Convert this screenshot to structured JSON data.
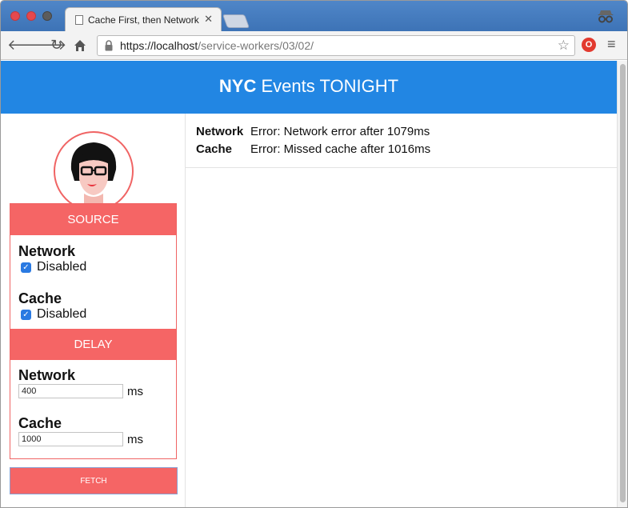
{
  "browser": {
    "tab_title": "Cache First, then Network",
    "url_host": "https://localhost",
    "url_path": "/service-workers/03/02/"
  },
  "page": {
    "header_bold": "NYC",
    "header_rest": " Events TONIGHT",
    "source_heading": "SOURCE",
    "source_network_title": "Network",
    "source_network_check": "Disabled",
    "source_cache_title": "Cache",
    "source_cache_check": "Disabled",
    "delay_heading": "DELAY",
    "delay_network_title": "Network",
    "delay_network_value": "400",
    "delay_network_unit": "ms",
    "delay_cache_title": "Cache",
    "delay_cache_value": "1000",
    "delay_cache_unit": "ms",
    "fetch_label": "FETCH",
    "log": [
      {
        "label": "Network",
        "message": "Error: Network error after 1079ms"
      },
      {
        "label": "Cache",
        "message": "Error: Missed cache after 1016ms"
      }
    ]
  },
  "colors": {
    "header": "#2286e3",
    "accent": "#f56565",
    "checkbox": "#2a7ae2"
  }
}
